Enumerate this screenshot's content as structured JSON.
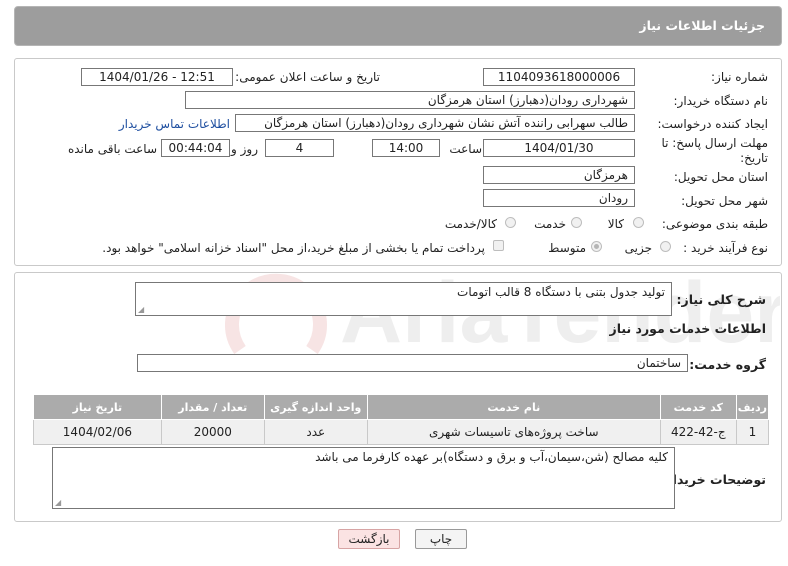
{
  "header": {
    "title": "جزئیات اطلاعات نیاز"
  },
  "form": {
    "need_number_label": "شماره نیاز:",
    "need_number": "1104093618000006",
    "announce_label": "تاریخ و ساعت اعلان عمومی:",
    "announce_value": "1404/01/26 - 12:51",
    "buyer_org_label": "نام دستگاه خریدار:",
    "buyer_org": "شهرداری رودان(دهبارز) استان هرمزگان",
    "creator_label": "ایجاد کننده درخواست:",
    "creator": "طالب سهرابی راننده آتش نشان شهرداری رودان(دهبارز) استان هرمزگان",
    "contact_link": "اطلاعات تماس خریدار",
    "deadline_label_1": "مهلت ارسال پاسخ: تا",
    "deadline_label_2": "تاریخ:",
    "deadline_date": "1404/01/30",
    "time_label": "ساعت",
    "deadline_time": "14:00",
    "days_value": "4",
    "days_label": "روز و",
    "remaining_time": "00:44:04",
    "remaining_label": "ساعت باقی مانده",
    "province_label": "استان محل تحویل:",
    "province": "هرمزگان",
    "city_label": "شهر محل تحویل:",
    "city": "رودان",
    "category_label": "طبقه بندی موضوعی:",
    "category_options": [
      "کالا",
      "خدمت",
      "کالا/خدمت"
    ],
    "process_label": "نوع فرآیند خرید :",
    "process_options": [
      "جزیی",
      "متوسط"
    ],
    "payment_note": "پرداخت تمام یا بخشی از مبلغ خرید،از محل \"اسناد خزانه اسلامی\" خواهد بود."
  },
  "details": {
    "summary_label": "شرح کلی نیاز:",
    "summary": "تولید جدول بتنی با دستگاه 8 قالب اتومات",
    "services_title": "اطلاعات خدمات مورد نیاز",
    "group_label": "گروه خدمت:",
    "group": "ساختمان",
    "table": {
      "headers": [
        "ردیف",
        "کد خدمت",
        "نام خدمت",
        "واحد اندازه گیری",
        "تعداد / مقدار",
        "تاریخ نیاز"
      ],
      "rows": [
        [
          "1",
          "ج-42-422",
          "ساخت پروژه‌های تاسیسات شهری",
          "عدد",
          "20000",
          "1404/02/06"
        ]
      ]
    },
    "buyer_notes_label": "توضیحات خریدار:",
    "buyer_notes": "کلیه مصالح (شن،سیمان،آب و برق و دستگاه)بر عهده کارفرما می باشد"
  },
  "buttons": {
    "print": "چاپ",
    "back": "بازگشت"
  },
  "watermark": {
    "text": "AriaTender.net"
  },
  "colors": {
    "header": "#9d9d9d",
    "link": "#1f4fa0",
    "back_button_bg": "#fbe3e3"
  }
}
